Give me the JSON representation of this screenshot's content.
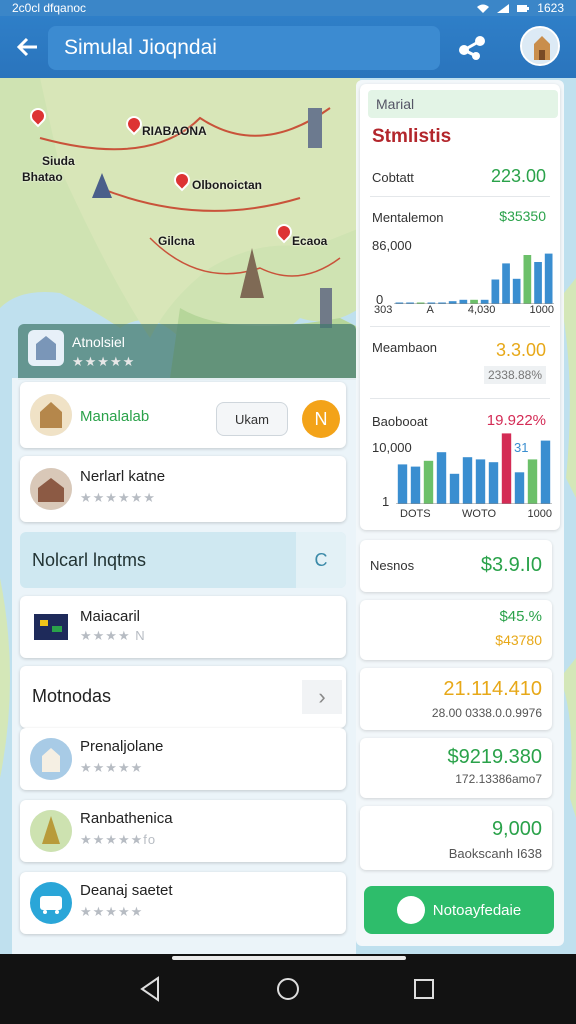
{
  "status_bar": {
    "left_text": "2c0cl dfqanoc",
    "time": "1623"
  },
  "app_bar": {
    "title": "Simulal Jioqndai"
  },
  "map": {
    "labels": [
      "RIABAONA",
      "Olbonoictan",
      "Siuda",
      "Bhatao",
      "Gilcna",
      "Ecaoa"
    ]
  },
  "location_card": {
    "name": "Atnolsiel",
    "rating_text": "★★★★★"
  },
  "list": {
    "featured": {
      "title": "Manalalab",
      "chip": "Ukam",
      "action_icon": "N"
    },
    "item2": {
      "title": "Nerlarl katne",
      "rating_text": "★★★★★★"
    },
    "section": {
      "label": "Nolcarl lnqtms",
      "icon": "C"
    },
    "item3": {
      "title": "Maiacaril",
      "sub": "★★★★ N"
    },
    "more": {
      "label": "Motnodas"
    },
    "items": [
      {
        "title": "Prenaljolane",
        "sub": "★★★★★"
      },
      {
        "title": "Ranbathenica",
        "sub": "★★★★★fo"
      },
      {
        "title": "Deanaj saetet",
        "sub": "★★★★★"
      }
    ]
  },
  "stats": {
    "tag": "Marial",
    "title": "Stmlistis",
    "rows": [
      {
        "label": "Cobtatt",
        "value": "223.00",
        "color": "#2aa24a"
      },
      {
        "label": "Mentalemon",
        "value": "$35350",
        "color": "#2aa24a"
      }
    ],
    "chart1": {
      "y_top": "86,000",
      "y_zero": "0",
      "x_labels": [
        "303",
        "A",
        "4,030",
        "1000"
      ],
      "bars": [
        0.02,
        0.02,
        0.02,
        0.02,
        0.02,
        0.04,
        0.06,
        0.06,
        0.06,
        0.35,
        0.58,
        0.36,
        0.7,
        0.6,
        0.72
      ]
    },
    "mid": {
      "label": "Meambaon",
      "value": "3.3.00",
      "sub": "2338.88%"
    },
    "chart2": {
      "label": "Baobooat",
      "value": "19.922%",
      "y_top": "10,000",
      "y_zero": "1",
      "note": "31",
      "x_labels": [
        "DOTS",
        "WOTO",
        "1000"
      ],
      "bars": [
        0.55,
        0.52,
        0.6,
        0.72,
        0.42,
        0.65,
        0.62,
        0.58,
        0.98,
        0.44,
        0.62,
        0.88
      ]
    }
  },
  "value_cards": [
    {
      "label": "Nesnos",
      "value": "$3.9.I0",
      "sub": "",
      "color": "#2aa24a"
    },
    {
      "label": "",
      "value": "$45.%",
      "sub": "$43780",
      "color": "#2aa24a",
      "sub_color": "#e7a818"
    },
    {
      "label": "",
      "value": "21.114.410",
      "sub": "28.00 0338.0.0.9976",
      "color": "#e7a818"
    },
    {
      "label": "",
      "value": "$9219.380",
      "sub": "172.13386amo7",
      "color": "#2aa24a"
    },
    {
      "label": "",
      "value": "9,000",
      "sub": "Baokscanh I638",
      "color": "#2aa24a"
    }
  ],
  "action_button": {
    "label": "Notoayfedaie"
  },
  "colors": {
    "primary": "#2f7fc8",
    "success": "#2ebd6b",
    "accent": "#f3a319",
    "danger": "#b3262c"
  }
}
